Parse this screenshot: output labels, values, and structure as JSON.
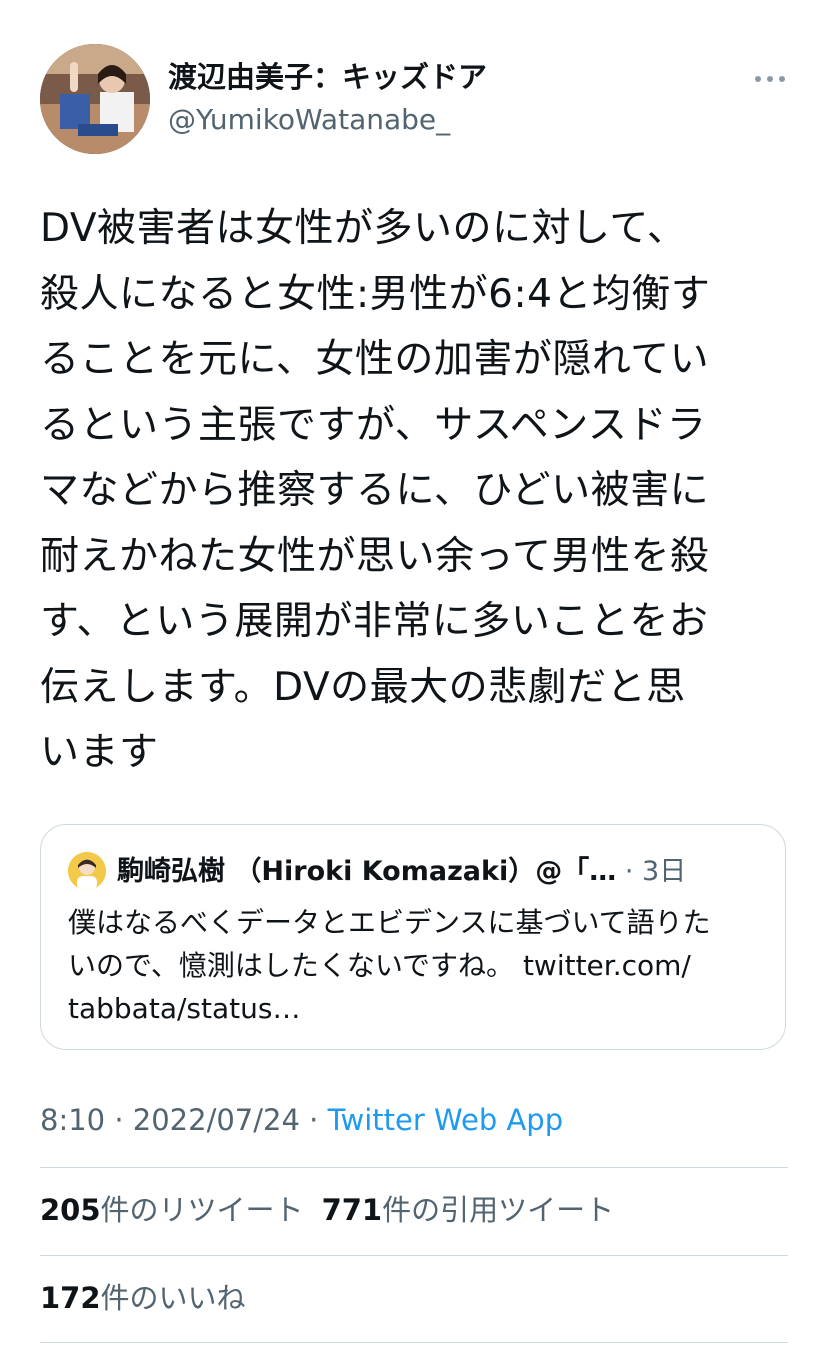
{
  "author": {
    "display_name": "渡辺由美子：キッズドア",
    "handle": "@YumikoWatanabe_"
  },
  "tweet": {
    "lines": [
      "DV被害者は女性が多いのに対して、",
      "殺人になると女性:男性が6:4と均衡す",
      "ることを元に、女性の加害が隠れてい",
      "るという主張ですが、サスペンスドラ",
      "マなどから推察するに、ひどい被害に",
      "耐えかねた女性が思い余って男性を殺",
      "す、という展開が非常に多いことをお",
      "伝えします。DVの最大の悲劇だと思",
      "います"
    ]
  },
  "quote": {
    "name": "駒崎弘樹 （Hiroki Komazaki）@「…",
    "dot": "·",
    "time": "3日",
    "lines": [
      "僕はなるべくデータとエビデンスに基づいて語りた",
      "いので、憶測はしたくないですね。 twitter.com/",
      "tabbata/status…"
    ]
  },
  "meta": {
    "time": "8:10",
    "sep1": " · ",
    "date": "2022/07/24",
    "sep2": " · ",
    "source": "Twitter Web App"
  },
  "stats": {
    "retweets_count": "205",
    "retweets_label": "件のリツイート",
    "quotes_count": "771",
    "quotes_label": "件の引用ツイート",
    "likes_count": "172",
    "likes_label": "件のいいね"
  },
  "colors": {
    "link": "#1d9bf0",
    "secondary_text": "#536471",
    "border": "#cfd9de"
  },
  "icons": {
    "more": "more-horizontal-icon"
  }
}
